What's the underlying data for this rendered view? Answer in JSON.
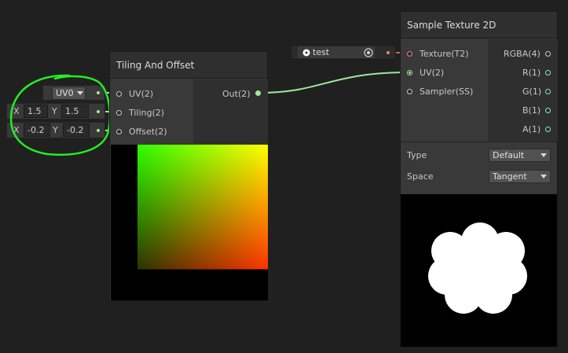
{
  "tiling_node": {
    "title": "Tiling And Offset",
    "inputs": [
      "UV(2)",
      "Tiling(2)",
      "Offset(2)"
    ],
    "output": "Out(2)"
  },
  "inline_inputs": {
    "uv_channel": "UV0",
    "tiling": {
      "x_label": "X",
      "x": "1.5",
      "y_label": "Y",
      "y": "1.5"
    },
    "offset": {
      "x_label": "X",
      "x": "-0.2",
      "y_label": "Y",
      "y": "-0.2"
    }
  },
  "texture_property": {
    "name": "test"
  },
  "sample_node": {
    "title": "Sample Texture 2D",
    "inputs": [
      "Texture(T2)",
      "UV(2)",
      "Sampler(SS)"
    ],
    "outputs": [
      "RGBA(4)",
      "R(1)",
      "G(1)",
      "B(1)",
      "A(1)"
    ],
    "settings": [
      {
        "label": "Type",
        "value": "Default"
      },
      {
        "label": "Space",
        "value": "Tangent"
      }
    ]
  },
  "colors": {
    "background": "#202020",
    "node_body": "#393939",
    "node_header": "#2f2f2f",
    "vector2_wire": "#9fe89a",
    "texture_port": "#f08080",
    "float_port": "#84e4e7",
    "annotation": "#22ee22"
  }
}
